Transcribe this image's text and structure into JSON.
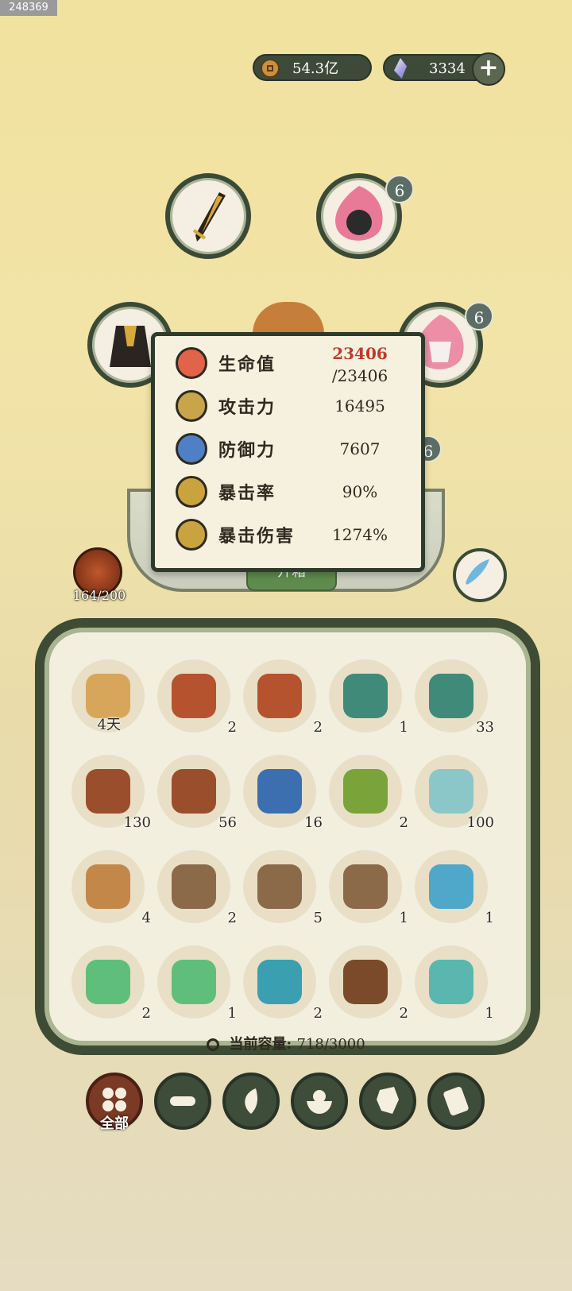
{
  "watermark": "248369",
  "header": {
    "coins": "54.3亿",
    "gems": "3334",
    "add_label": "+"
  },
  "equipment": {
    "slots": [
      {
        "name": "weapon-sword",
        "icon": "sword-icon"
      },
      {
        "name": "spirit-snake",
        "icon": "snake-spirit-icon",
        "badge": "6"
      },
      {
        "name": "armor",
        "icon": "armor-icon"
      },
      {
        "name": "spirit-deer",
        "icon": "deer-spirit-icon",
        "badge": "6"
      },
      {
        "name": "hidden",
        "badge": "6"
      }
    ]
  },
  "open_button_label": "开箱",
  "stats": [
    {
      "label": "生命值",
      "value": "23406",
      "max": "/23406",
      "icon": "heart-icon",
      "color": "#e0634a"
    },
    {
      "label": "攻击力",
      "value": "16495",
      "icon": "sword-icon",
      "color": "#c8a54a"
    },
    {
      "label": "防御力",
      "value": "7607",
      "icon": "person-icon",
      "color": "#4f7fc4"
    },
    {
      "label": "暴击率",
      "value": "90%",
      "icon": "crit-icon",
      "color": "#c9a33e"
    },
    {
      "label": "暴击伤害",
      "value": "1274%",
      "icon": "crit-damage-icon",
      "color": "#c9a33e"
    }
  ],
  "hero": {
    "count": "164/200"
  },
  "inventory": {
    "items": [
      {
        "name": "scroll",
        "qty": "4天",
        "color": "#d8a65a"
      },
      {
        "name": "red-chest",
        "qty": "2",
        "color": "#b5532f"
      },
      {
        "name": "red-chest-2",
        "qty": "2",
        "color": "#b5532f"
      },
      {
        "name": "green-chest",
        "qty": "1",
        "color": "#3f8a78"
      },
      {
        "name": "green-chest-2",
        "qty": "33",
        "color": "#3f8a78"
      },
      {
        "name": "brown-chest",
        "qty": "130",
        "color": "#9b4e2c"
      },
      {
        "name": "brown-chest-2",
        "qty": "56",
        "color": "#9b4e2c"
      },
      {
        "name": "blue-chest",
        "qty": "16",
        "color": "#3b6fb0"
      },
      {
        "name": "jade-box",
        "qty": "2",
        "color": "#7aa33a"
      },
      {
        "name": "spirit-stone",
        "qty": "100",
        "color": "#8bc7c9"
      },
      {
        "name": "pouch",
        "qty": "4",
        "color": "#c4874a"
      },
      {
        "name": "book",
        "qty": "2",
        "color": "#8b6a4a"
      },
      {
        "name": "book-2",
        "qty": "5",
        "color": "#8b6a4a"
      },
      {
        "name": "book-3",
        "qty": "1",
        "color": "#8b6a4a"
      },
      {
        "name": "fish",
        "qty": "1",
        "color": "#4fa7c9"
      },
      {
        "name": "potion",
        "qty": "2",
        "color": "#5fbf7a"
      },
      {
        "name": "potion-2",
        "qty": "1",
        "color": "#5fbf7a"
      },
      {
        "name": "beast-soul",
        "qty": "2",
        "color": "#3a9fb0"
      },
      {
        "name": "seeds",
        "qty": "2",
        "color": "#7a4a2a"
      },
      {
        "name": "pearls",
        "qty": "1",
        "color": "#5ab7b0"
      }
    ]
  },
  "capacity": {
    "label": "当前容量:",
    "value": "718/3000"
  },
  "tabs": [
    {
      "name": "all",
      "label": "全部",
      "icon": "grid-icon",
      "active": true
    },
    {
      "name": "wood",
      "icon": "log-icon"
    },
    {
      "name": "herb",
      "icon": "leaf-icon"
    },
    {
      "name": "food",
      "icon": "bowl-icon"
    },
    {
      "name": "ore",
      "icon": "ore-icon"
    },
    {
      "name": "scroll",
      "icon": "scroll-icon"
    }
  ]
}
